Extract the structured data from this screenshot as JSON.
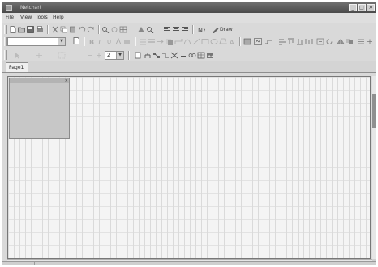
{
  "app": {
    "title": "Netchart"
  },
  "menu": [
    "File",
    "View",
    "Tools",
    "Help"
  ],
  "toolbar": {
    "style_label": "Draw",
    "zoom_value": "2"
  },
  "tabs": [
    {
      "label": "Page1"
    }
  ],
  "icons": [
    "new-icon",
    "open-icon",
    "save-icon",
    "print-icon",
    "cut-icon",
    "copy-icon",
    "paste-icon",
    "undo-icon",
    "redo-icon",
    "grid-icon",
    "align-icon",
    "connector-icon",
    "shape-icon",
    "zoom-icon",
    "text-icon"
  ],
  "colors": {
    "title_bar": "#555555",
    "workspace": "#f4f4f4",
    "grid_line": "#dadada",
    "palette": "#c7c7c7"
  }
}
